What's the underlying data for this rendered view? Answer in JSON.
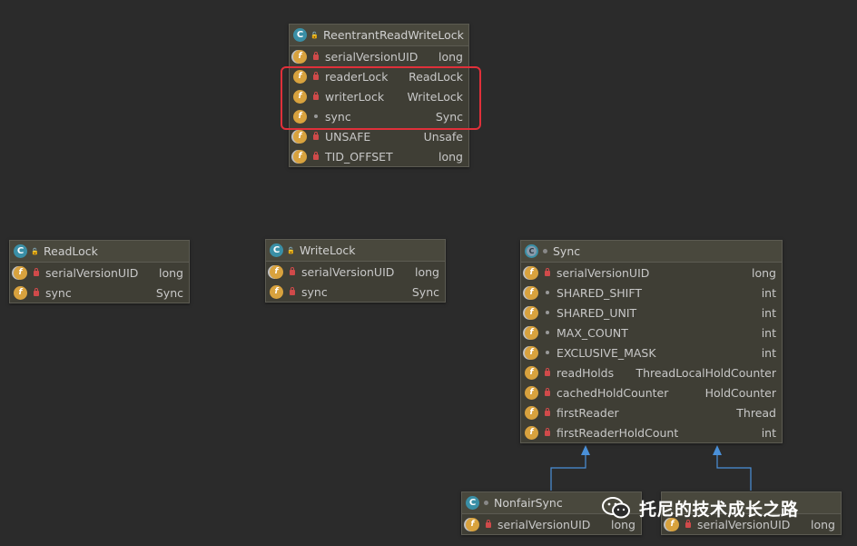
{
  "classes": {
    "rrwl": {
      "name": "ReentrantReadWriteLock",
      "fields": [
        {
          "name": "serialVersionUID",
          "type": "long"
        },
        {
          "name": "readerLock",
          "type": "ReadLock"
        },
        {
          "name": "writerLock",
          "type": "WriteLock"
        },
        {
          "name": "sync",
          "type": "Sync"
        },
        {
          "name": "UNSAFE",
          "type": "Unsafe"
        },
        {
          "name": "TID_OFFSET",
          "type": "long"
        }
      ]
    },
    "readlock": {
      "name": "ReadLock",
      "fields": [
        {
          "name": "serialVersionUID",
          "type": "long"
        },
        {
          "name": "sync",
          "type": "Sync"
        }
      ]
    },
    "writelock": {
      "name": "WriteLock",
      "fields": [
        {
          "name": "serialVersionUID",
          "type": "long"
        },
        {
          "name": "sync",
          "type": "Sync"
        }
      ]
    },
    "sync": {
      "name": "Sync",
      "fields": [
        {
          "name": "serialVersionUID",
          "type": "long"
        },
        {
          "name": "SHARED_SHIFT",
          "type": "int"
        },
        {
          "name": "SHARED_UNIT",
          "type": "int"
        },
        {
          "name": "MAX_COUNT",
          "type": "int"
        },
        {
          "name": "EXCLUSIVE_MASK",
          "type": "int"
        },
        {
          "name": "readHolds",
          "type": "ThreadLocalHoldCounter"
        },
        {
          "name": "cachedHoldCounter",
          "type": "HoldCounter"
        },
        {
          "name": "firstReader",
          "type": "Thread"
        },
        {
          "name": "firstReaderHoldCount",
          "type": "int"
        }
      ]
    },
    "nonfair": {
      "name": "NonfairSync",
      "fields": [
        {
          "name": "serialVersionUID",
          "type": "long"
        }
      ]
    },
    "fair": {
      "fields": [
        {
          "name": "serialVersionUID",
          "type": "long"
        }
      ]
    }
  },
  "watermark": {
    "text": "托尼的技术成长之路"
  },
  "colors": {
    "background": "#2b2b2b",
    "highlight": "#e0303a",
    "arrow": "#4a90d9"
  }
}
